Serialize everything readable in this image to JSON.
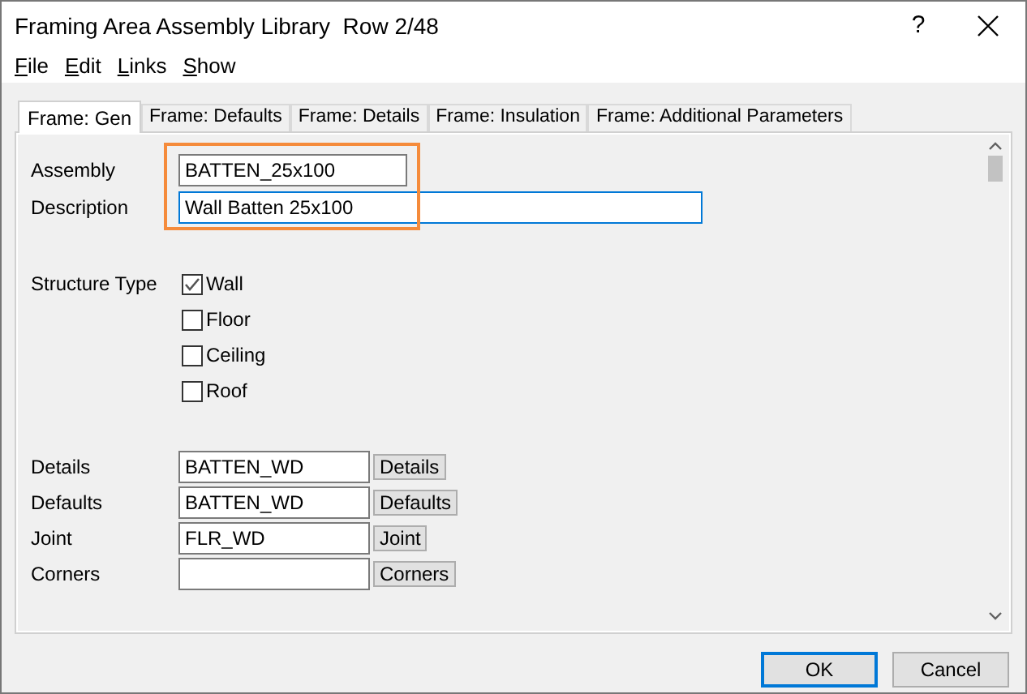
{
  "window": {
    "title": "Framing Area Assembly Library  Row 2/48",
    "help": "?"
  },
  "menu": [
    "File",
    "Edit",
    "Links",
    "Show"
  ],
  "tabs": [
    {
      "label": "Frame: Gen",
      "selected": true
    },
    {
      "label": "Frame: Defaults",
      "selected": false
    },
    {
      "label": "Frame: Details",
      "selected": false
    },
    {
      "label": "Frame: Insulation",
      "selected": false
    },
    {
      "label": "Frame: Additional Parameters",
      "selected": false
    }
  ],
  "fields": [
    {
      "label": "Assembly",
      "value": "BATTEN_25x100",
      "focused": false
    },
    {
      "label": "Description",
      "value": "Wall Batten 25x100",
      "focused": true
    }
  ],
  "structure_type": {
    "label": "Structure Type",
    "options": [
      {
        "label": "Wall",
        "checked": true
      },
      {
        "label": "Floor",
        "checked": false
      },
      {
        "label": "Ceiling",
        "checked": false
      },
      {
        "label": "Roof",
        "checked": false
      }
    ]
  },
  "links": [
    {
      "label": "Details",
      "value": "BATTEN_WD",
      "button": "Details"
    },
    {
      "label": "Defaults",
      "value": "BATTEN_WD",
      "button": "Defaults"
    },
    {
      "label": "Joint",
      "value": "FLR_WD",
      "button": "Joint"
    },
    {
      "label": "Corners",
      "button": "Corners"
    }
  ],
  "buttons": [
    {
      "label": "OK",
      "default": true
    },
    {
      "label": "Cancel",
      "default": false
    }
  ]
}
